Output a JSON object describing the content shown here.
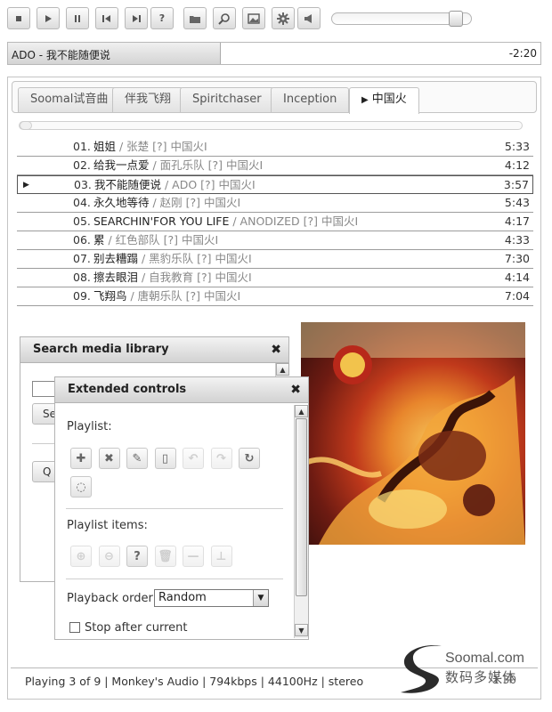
{
  "toolbar": {
    "buttons": [
      {
        "id": "stop",
        "icon": "stop-icon"
      },
      {
        "id": "play",
        "icon": "play-icon"
      },
      {
        "id": "pause",
        "icon": "pause-icon"
      },
      {
        "id": "previous",
        "icon": "previous-icon"
      },
      {
        "id": "next",
        "icon": "next-icon"
      },
      {
        "id": "random",
        "icon": "question-icon",
        "label": "?"
      },
      {
        "id": "open",
        "icon": "folder-icon"
      },
      {
        "id": "search",
        "icon": "magnifier-icon"
      },
      {
        "id": "image",
        "icon": "image-icon"
      },
      {
        "id": "settings",
        "icon": "gear-icon"
      },
      {
        "id": "volume",
        "icon": "speaker-icon"
      }
    ],
    "volume_level": 0.93
  },
  "now_playing": {
    "title": "ADO - 我不能随便说",
    "time": "-2:20",
    "progress": 0.4
  },
  "tabs": [
    {
      "label": "Soomal试音曲",
      "active": false
    },
    {
      "label": "伴我飞翔",
      "active": false
    },
    {
      "label": "Spiritchaser",
      "active": false
    },
    {
      "label": "Inception",
      "active": false
    },
    {
      "label": "中国火",
      "active": true,
      "marker": "▶"
    }
  ],
  "playlist": [
    {
      "num": "01.",
      "title": "姐姐",
      "meta": " / 张楚 [?] 中国火I",
      "duration": "5:33",
      "current": false
    },
    {
      "num": "02.",
      "title": "给我一点爱",
      "meta": " / 面孔乐队 [?] 中国火I",
      "duration": "4:12",
      "current": false
    },
    {
      "num": "03.",
      "title": "我不能随便说",
      "meta": " / ADO [?] 中国火I",
      "duration": "3:57",
      "current": true
    },
    {
      "num": "04.",
      "title": "永久地等待",
      "meta": " / 赵刚 [?] 中国火I",
      "duration": "5:43",
      "current": false
    },
    {
      "num": "05.",
      "title": "SEARCHIN'FOR YOU LIFE",
      "meta": " / ANODIZED [?] 中国火I",
      "duration": "4:17",
      "current": false
    },
    {
      "num": "06.",
      "title": "累",
      "meta": " / 红色部队 [?] 中国火I",
      "duration": "4:33",
      "current": false
    },
    {
      "num": "07.",
      "title": "别去糟蹋",
      "meta": " / 黑豹乐队 [?] 中国火I",
      "duration": "7:30",
      "current": false
    },
    {
      "num": "08.",
      "title": "擦去眼泪",
      "meta": " / 自我教育 [?] 中国火I",
      "duration": "4:14",
      "current": false
    },
    {
      "num": "09.",
      "title": "飞翔鸟",
      "meta": " / 唐朝乐队 [?] 中国火I",
      "duration": "7:04",
      "current": false
    }
  ],
  "current_marker": "▶",
  "search_panel": {
    "title": "Search media library",
    "close": "✖",
    "button1_partial": "Se",
    "button2_partial": "Q"
  },
  "extended_controls": {
    "title": "Extended controls",
    "close": "✖",
    "playlist_label": "Playlist:",
    "playlist_buttons": [
      {
        "icon": "plus-icon",
        "glyph": "✚",
        "enabled": true
      },
      {
        "icon": "remove-icon",
        "glyph": "✖",
        "enabled": true
      },
      {
        "icon": "pencil-icon",
        "glyph": "✎",
        "enabled": true
      },
      {
        "icon": "clipboard-icon",
        "glyph": "▯",
        "enabled": true
      },
      {
        "icon": "undo-icon",
        "glyph": "↶",
        "enabled": false
      },
      {
        "icon": "redo-icon",
        "glyph": "↷",
        "enabled": false
      },
      {
        "icon": "refresh-icon",
        "glyph": "↻",
        "enabled": true
      },
      {
        "icon": "lightbulb-icon",
        "glyph": "◌",
        "enabled": true
      }
    ],
    "items_label": "Playlist items:",
    "item_buttons": [
      {
        "icon": "add-circle-icon",
        "glyph": "⊕",
        "enabled": false
      },
      {
        "icon": "minus-circle-icon",
        "glyph": "⊖",
        "enabled": false
      },
      {
        "icon": "question-icon",
        "glyph": "?",
        "enabled": true
      },
      {
        "icon": "trash-icon",
        "glyph": "🗑",
        "enabled": false
      },
      {
        "icon": "dash-icon",
        "glyph": "—",
        "enabled": false
      },
      {
        "icon": "pin-icon",
        "glyph": "⊥",
        "enabled": false
      }
    ],
    "order_label": "Playback order",
    "order_value": "Random",
    "stop_after_current": "Stop after current",
    "stop_after_checked": false
  },
  "status": {
    "text": "Playing 3 of 9 | Monkey's Audio | 794kbps | 44100Hz | stereo",
    "time": "1:30"
  },
  "watermark": {
    "line1": "Soomal.com",
    "line2": "数码多媒体"
  },
  "colors": {
    "accent": "#c0391b",
    "border": "#b9b9b9",
    "meta_text": "#888888"
  }
}
